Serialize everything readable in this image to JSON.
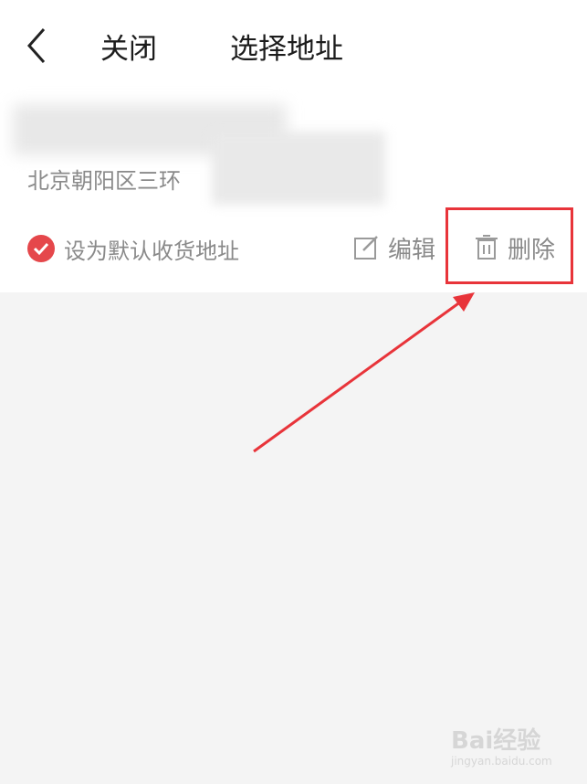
{
  "header": {
    "close_label": "关闭",
    "title": "选择地址"
  },
  "address_card": {
    "address_line": "北京朝阳区三环",
    "set_default_label": "设为默认收货地址",
    "edit_label": "编辑",
    "delete_label": "删除"
  },
  "colors": {
    "accent_red": "#e8343a",
    "check_red": "#e5474b",
    "text_gray": "#8a8a8a",
    "page_bg": "#f4f4f4"
  },
  "watermark": {
    "brand": "Bai经验",
    "url": "jingyan.baidu.com"
  }
}
